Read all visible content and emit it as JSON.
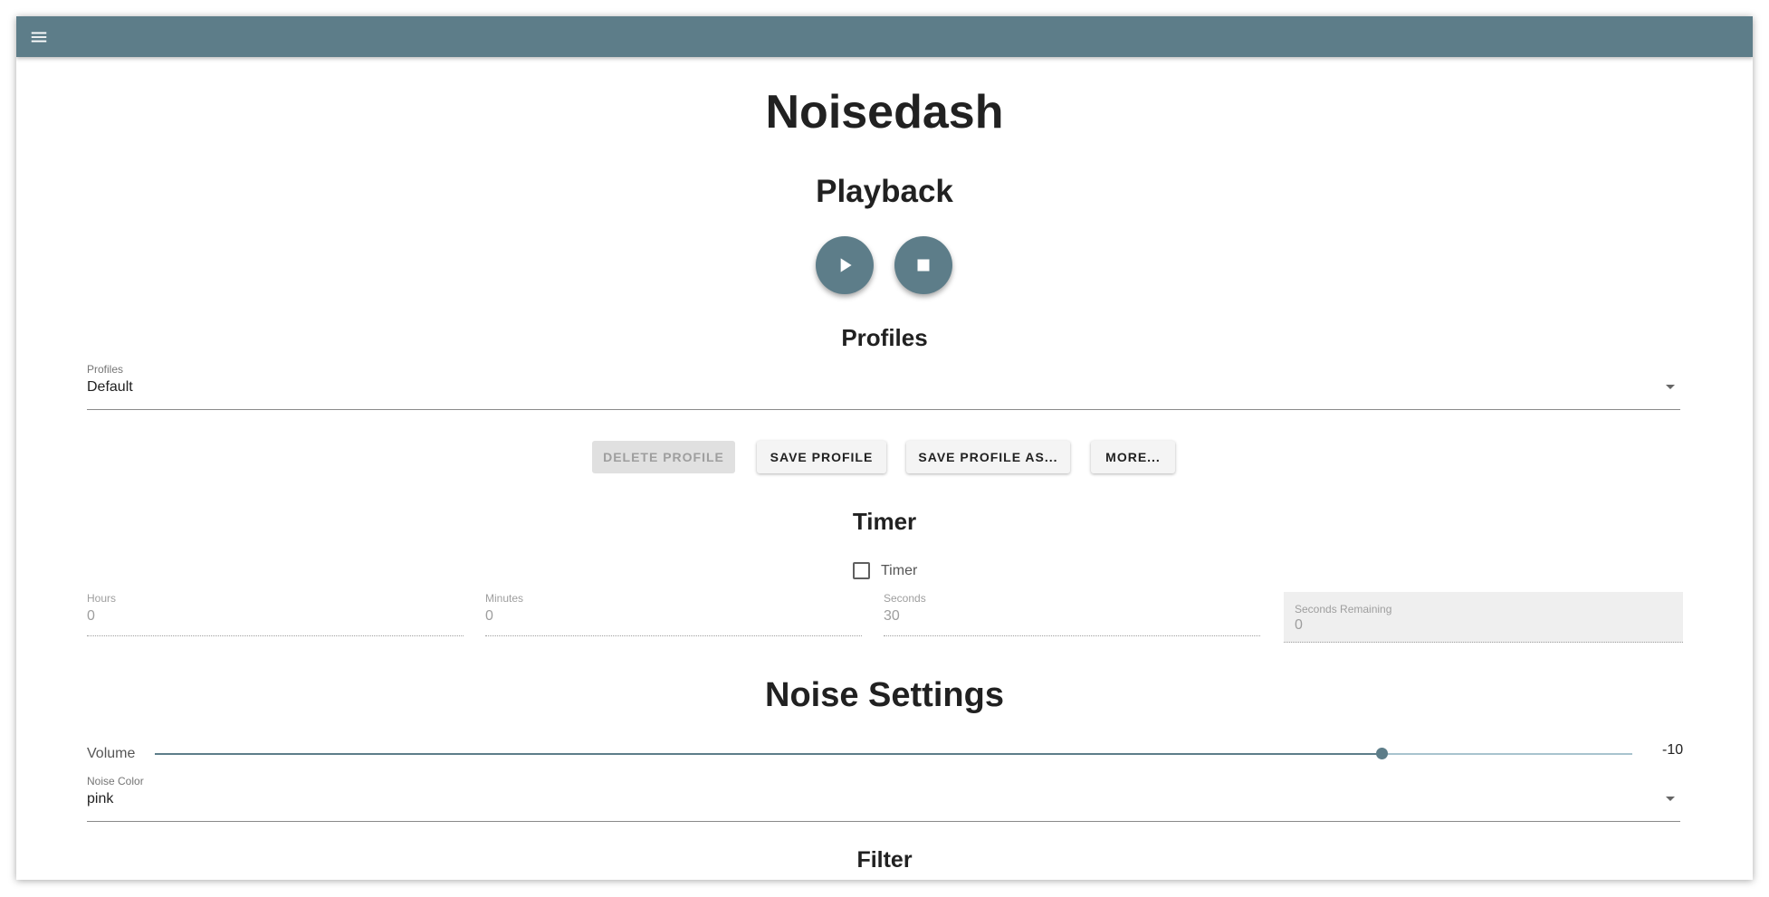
{
  "app": {
    "title": "Noisedash",
    "menu_icon": "menu-icon",
    "accent_color": "#5d7d89"
  },
  "playback": {
    "heading": "Playback",
    "play_icon": "play-icon",
    "stop_icon": "stop-icon"
  },
  "profiles": {
    "heading": "Profiles",
    "select_label": "Profiles",
    "selected": "Default",
    "buttons": {
      "delete": "DELETE PROFILE",
      "save": "SAVE PROFILE",
      "save_as": "SAVE PROFILE AS...",
      "more": "MORE..."
    }
  },
  "timer": {
    "heading": "Timer",
    "checkbox_label": "Timer",
    "checked": false,
    "fields": {
      "hours": {
        "label": "Hours",
        "value": "0"
      },
      "minutes": {
        "label": "Minutes",
        "value": "0"
      },
      "seconds": {
        "label": "Seconds",
        "value": "30"
      },
      "remaining": {
        "label": "Seconds Remaining",
        "value": "0"
      }
    }
  },
  "noise": {
    "heading": "Noise Settings",
    "volume_label": "Volume",
    "volume_value": "-10",
    "volume_fraction": 0.83,
    "color_label": "Noise Color",
    "color_selected": "pink"
  },
  "filter": {
    "heading": "Filter"
  }
}
